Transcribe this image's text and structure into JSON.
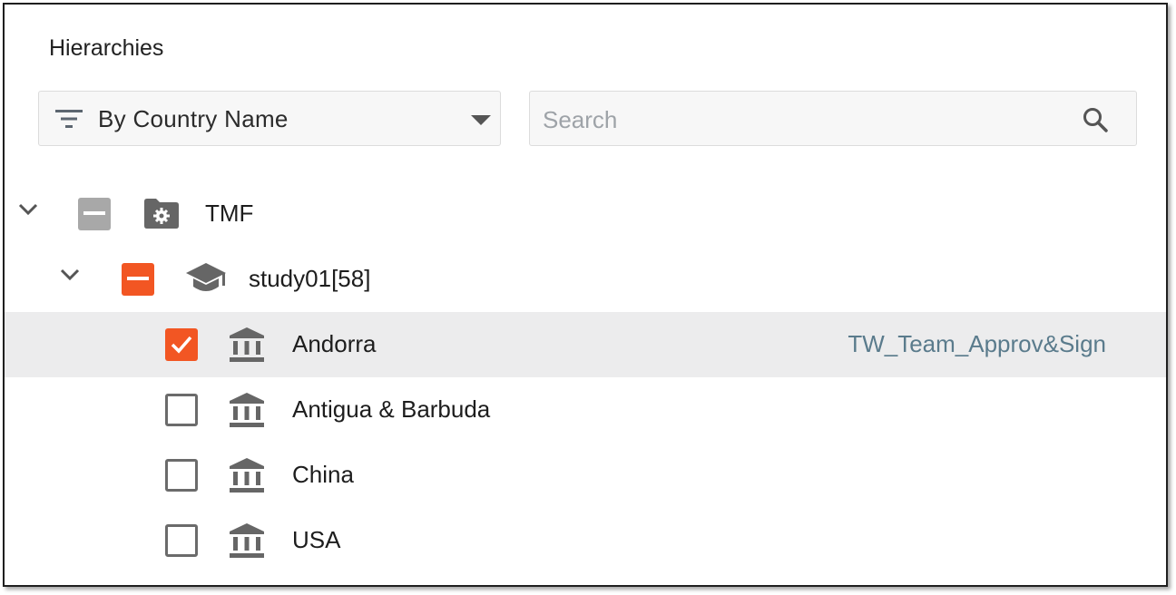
{
  "panel": {
    "title": "Hierarchies",
    "filter": {
      "selected_label": "By Country Name"
    },
    "search": {
      "placeholder": "Search",
      "value": ""
    }
  },
  "tree": {
    "root": {
      "label": "TMF",
      "checkbox_state": "indeterminate",
      "expanded": true
    },
    "study": {
      "label": "study01[58]",
      "checkbox_state": "indeterminate",
      "expanded": true
    },
    "countries": [
      {
        "label": "Andorra",
        "checked": true,
        "selected": true,
        "tag": "TW_Team_Approv&Sign"
      },
      {
        "label": "Antigua & Barbuda",
        "checked": false,
        "selected": false,
        "tag": ""
      },
      {
        "label": "China",
        "checked": false,
        "selected": false,
        "tag": ""
      },
      {
        "label": "USA",
        "checked": false,
        "selected": false,
        "tag": ""
      }
    ]
  },
  "colors": {
    "accent": "#f25623",
    "indeterminate_grey": "#a8a8a8",
    "icon_grey": "#6b6b6b",
    "tag_text": "#5a7b8c",
    "selected_row": "#ececed"
  },
  "icons": {
    "filter": "filter-icon",
    "caret": "caret-down-icon",
    "search": "search-icon",
    "expand": "chevron-down-icon",
    "root": "settings-folder-icon",
    "study": "graduation-cap-icon",
    "country": "institution-icon"
  }
}
